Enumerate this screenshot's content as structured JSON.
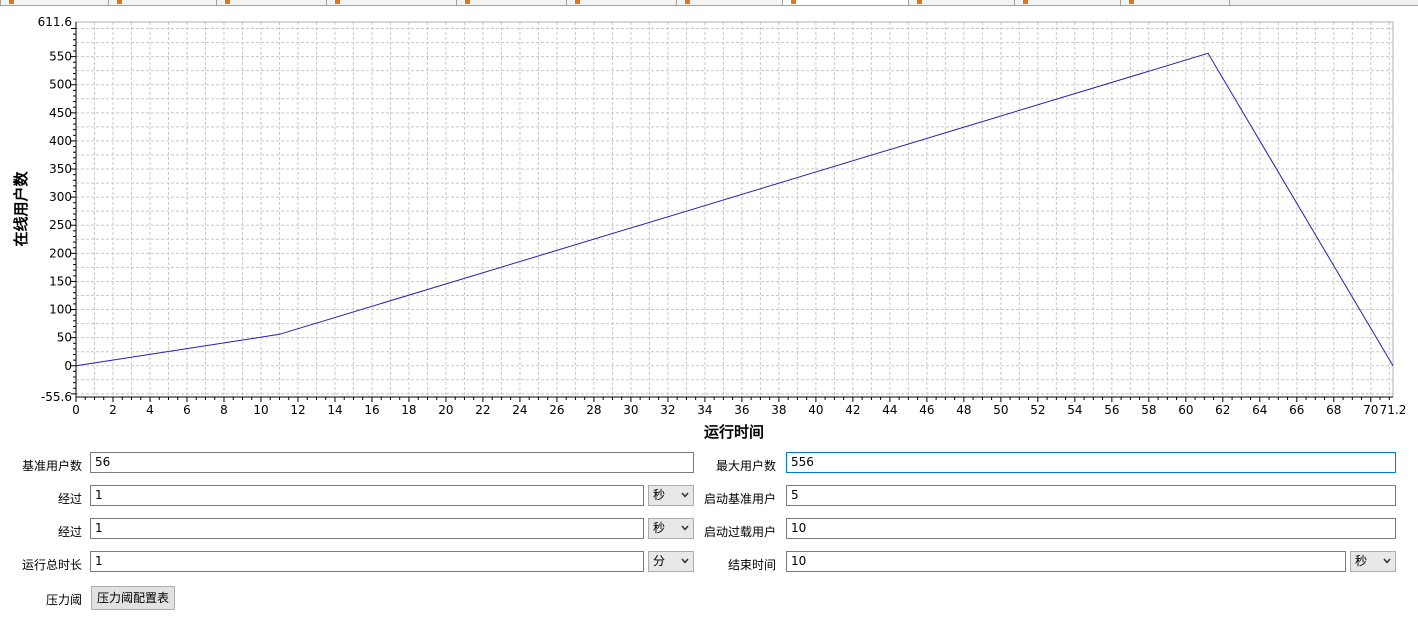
{
  "chart_data": {
    "type": "line",
    "title": "",
    "xlabel": "运行时间",
    "ylabel": "在线用户数",
    "xlim": [
      0,
      71.2
    ],
    "ylim": [
      -55.6,
      611.6
    ],
    "x_ticks": [
      "0",
      "2",
      "4",
      "6",
      "8",
      "10",
      "12",
      "14",
      "16",
      "18",
      "20",
      "22",
      "24",
      "26",
      "28",
      "30",
      "32",
      "34",
      "36",
      "38",
      "40",
      "42",
      "44",
      "46",
      "48",
      "50",
      "52",
      "54",
      "56",
      "58",
      "60",
      "62",
      "64",
      "66",
      "68",
      "70",
      "71.2"
    ],
    "y_ticks": [
      "611.6",
      "550",
      "500",
      "450",
      "400",
      "350",
      "300",
      "250",
      "200",
      "150",
      "100",
      "50",
      "0",
      "-55.6"
    ],
    "grid": true,
    "line_color": "#2020b0",
    "series": [
      {
        "x": [
          0,
          11,
          61.2,
          71.2
        ],
        "y": [
          0,
          56,
          556,
          0
        ]
      }
    ]
  },
  "form": {
    "base_users_label": "基准用户数",
    "base_users_value": "56",
    "max_users_label": "最大用户数",
    "max_users_value": "556",
    "elapse1_label": "经过",
    "elapse1_value": "1",
    "elapse1_unit": "秒",
    "start_base_label": "启动基准用户",
    "start_base_value": "5",
    "elapse2_label": "经过",
    "elapse2_value": "1",
    "elapse2_unit": "秒",
    "start_overload_label": "启动过载用户",
    "start_overload_value": "10",
    "total_label": "运行总时长",
    "total_value": "1",
    "total_unit": "分",
    "end_label": "结束时间",
    "end_value": "10",
    "end_unit": "秒",
    "pressure_label": "压力阈",
    "pressure_button": "压力阈配置表"
  }
}
